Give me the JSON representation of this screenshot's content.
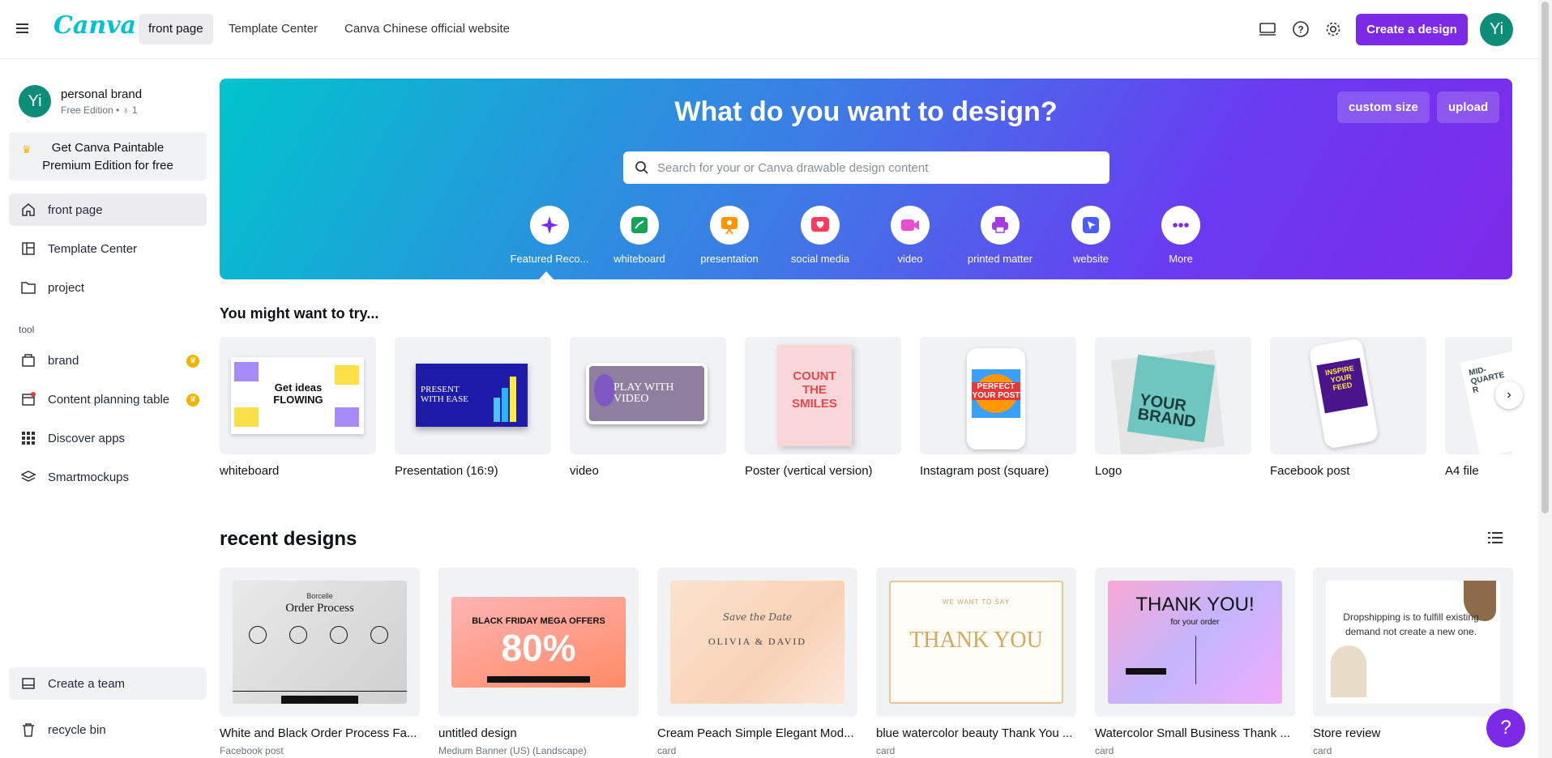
{
  "header": {
    "logo": "Canva",
    "tabs": [
      {
        "label": "front page"
      },
      {
        "label": "Template Center"
      },
      {
        "label": "Canva Chinese official website"
      }
    ],
    "create_label": "Create a design",
    "avatar": "Yi"
  },
  "sidebar": {
    "avatar": "Yi",
    "brand_name": "personal brand",
    "brand_sub": "Free Edition  •  ♁ 1",
    "promo": "Get Canva Paintable Premium Edition for free",
    "items": [
      {
        "label": "front page"
      },
      {
        "label": "Template Center"
      },
      {
        "label": "project"
      }
    ],
    "tool_header": "tool",
    "tools": [
      {
        "label": "brand"
      },
      {
        "label": "Content planning table"
      },
      {
        "label": "Discover apps"
      },
      {
        "label": "Smartmockups"
      }
    ],
    "create_team": "Create a team",
    "recycle": "recycle bin"
  },
  "hero": {
    "title": "What do you want to design?",
    "custom_size": "custom size",
    "upload": "upload",
    "search_placeholder": "Search for your or Canva drawable design content",
    "categories": [
      {
        "label": "Featured Reco...",
        "icon": "sparkle-icon",
        "color": "#7d2ae8"
      },
      {
        "label": "whiteboard",
        "icon": "whiteboard-icon",
        "color": "#13a35b"
      },
      {
        "label": "presentation",
        "icon": "presentation-icon",
        "color": "#ff9500"
      },
      {
        "label": "social media",
        "icon": "heart-icon",
        "color": "#ff3b5c"
      },
      {
        "label": "video",
        "icon": "video-icon",
        "color": "#e84fd0"
      },
      {
        "label": "printed matter",
        "icon": "printer-icon",
        "color": "#a23ce0"
      },
      {
        "label": "website",
        "icon": "cursor-icon",
        "color": "#4b5cf6"
      },
      {
        "label": "More",
        "icon": "more-icon",
        "color": "#7d2ae8"
      }
    ]
  },
  "try": {
    "title": "You might want to try...",
    "items": [
      {
        "label": "whiteboard",
        "art": "Get ideas FLOWING"
      },
      {
        "label": "Presentation (16:9)",
        "art": "PRESENT WITH EASE"
      },
      {
        "label": "video",
        "art": "PLAY WITH VIDEO"
      },
      {
        "label": "Poster (vertical version)",
        "art": "COUNT THE SMILES"
      },
      {
        "label": "Instagram post (square)",
        "art": "PERFECT YOUR POST"
      },
      {
        "label": "Logo",
        "art": "YOUR BRAND"
      },
      {
        "label": "Facebook post",
        "art": "INSPIRE YOUR FEED"
      },
      {
        "label": "A4 file",
        "art": "MID-QUARTE R"
      }
    ]
  },
  "recent": {
    "title": "recent designs",
    "items": [
      {
        "label": "White and Black Order Process Fa...",
        "sub": "Facebook post",
        "art": "Order Process",
        "art_top": "Borcelle"
      },
      {
        "label": "untitled design",
        "sub": "Medium Banner (US) (Landscape)",
        "art": "BLACK FRIDAY MEGA OFFERS",
        "art_big": "80%"
      },
      {
        "label": "Cream Peach Simple Elegant Mod...",
        "sub": "card",
        "art": "OLIVIA & DAVID",
        "art_top": "Save the Date"
      },
      {
        "label": "blue watercolor beauty Thank You ...",
        "sub": "card",
        "art": "THANK YOU",
        "art_top": "WE WANT TO SAY"
      },
      {
        "label": "Watercolor Small Business Thank ...",
        "sub": "card",
        "art": "THANK YOU!",
        "art_top": "for your order"
      },
      {
        "label": "Store review",
        "sub": "card",
        "art": "Dropshipping is to fulfill existing demand not create a new one."
      }
    ]
  },
  "help": "?"
}
